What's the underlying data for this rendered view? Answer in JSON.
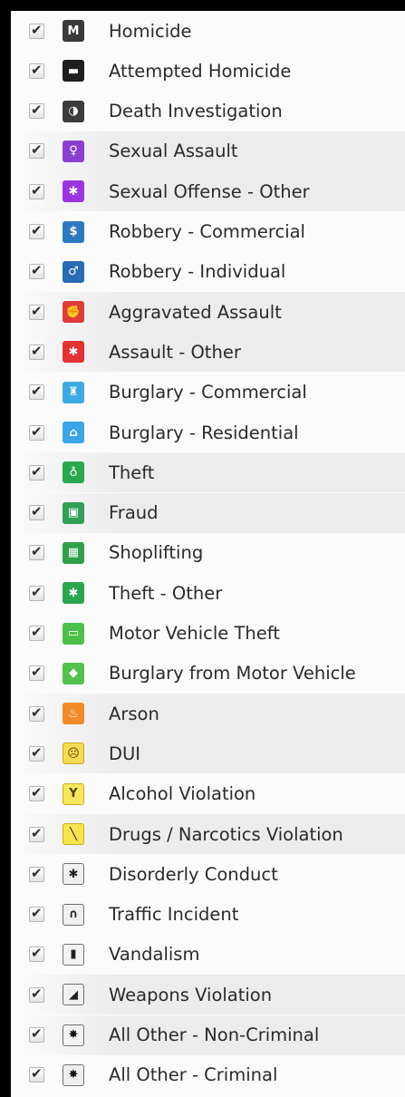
{
  "items": [
    {
      "label": "Homicide",
      "icon": "homicide-icon",
      "glyph": "M",
      "bg": "#3a3a3a",
      "fg": "#ffffff",
      "border": ""
    },
    {
      "label": "Attempted Homicide",
      "icon": "attempted-homicide-icon",
      "glyph": "▬",
      "bg": "#1e1e1e",
      "fg": "#ffffff",
      "border": ""
    },
    {
      "label": "Death Investigation",
      "icon": "death-investigation-icon",
      "glyph": "◑",
      "bg": "#3c3c3c",
      "fg": "#ffffff",
      "border": ""
    },
    {
      "label": "Sexual Assault",
      "icon": "sexual-assault-icon",
      "glyph": "♀",
      "bg": "#8b3fd0",
      "fg": "#ffffff",
      "border": ""
    },
    {
      "label": "Sexual Offense - Other",
      "icon": "sexual-offense-other-icon",
      "glyph": "✱",
      "bg": "#9a35e0",
      "fg": "#ffffff",
      "border": ""
    },
    {
      "label": "Robbery - Commercial",
      "icon": "robbery-commercial-icon",
      "glyph": "$",
      "bg": "#2d79c2",
      "fg": "#ffffff",
      "border": ""
    },
    {
      "label": "Robbery - Individual",
      "icon": "robbery-individual-icon",
      "glyph": "♂",
      "bg": "#2a6bb5",
      "fg": "#ffffff",
      "border": ""
    },
    {
      "label": "Aggravated Assault",
      "icon": "aggravated-assault-icon",
      "glyph": "✊",
      "bg": "#e03a3a",
      "fg": "#ffffff",
      "border": ""
    },
    {
      "label": "Assault - Other",
      "icon": "assault-other-icon",
      "glyph": "✱",
      "bg": "#e43232",
      "fg": "#ffffff",
      "border": ""
    },
    {
      "label": "Burglary - Commercial",
      "icon": "burglary-commercial-icon",
      "glyph": "♜",
      "bg": "#3fa9e6",
      "fg": "#ffffff",
      "border": ""
    },
    {
      "label": "Burglary - Residential",
      "icon": "burglary-residential-icon",
      "glyph": "⌂",
      "bg": "#3aa6e8",
      "fg": "#ffffff",
      "border": ""
    },
    {
      "label": "Theft",
      "icon": "theft-icon",
      "glyph": "♁",
      "bg": "#2aa84e",
      "fg": "#ffffff",
      "border": ""
    },
    {
      "label": "Fraud",
      "icon": "fraud-icon",
      "glyph": "▣",
      "bg": "#30a055",
      "fg": "#ffffff",
      "border": ""
    },
    {
      "label": "Shoplifting",
      "icon": "shoplifting-icon",
      "glyph": "▦",
      "bg": "#2ea04c",
      "fg": "#ffffff",
      "border": ""
    },
    {
      "label": "Theft - Other",
      "icon": "theft-other-icon",
      "glyph": "✱",
      "bg": "#2aa650",
      "fg": "#ffffff",
      "border": ""
    },
    {
      "label": "Motor Vehicle Theft",
      "icon": "motor-vehicle-theft-icon",
      "glyph": "▭",
      "bg": "#4cc14a",
      "fg": "#ffffff",
      "border": ""
    },
    {
      "label": "Burglary from Motor Vehicle",
      "icon": "burglary-from-motor-vehicle-icon",
      "glyph": "◆",
      "bg": "#52c24c",
      "fg": "#ffffff",
      "border": ""
    },
    {
      "label": "Arson",
      "icon": "arson-icon",
      "glyph": "♨",
      "bg": "#f28a2a",
      "fg": "#ffffff",
      "border": ""
    },
    {
      "label": "DUI",
      "icon": "dui-icon",
      "glyph": "☹",
      "bg": "#f5dc55",
      "fg": "#5a4a00",
      "border": "#c9a820"
    },
    {
      "label": "Alcohol Violation",
      "icon": "alcohol-violation-icon",
      "glyph": "Y",
      "bg": "#f7e65a",
      "fg": "#4a4000",
      "border": "#c9b020"
    },
    {
      "label": "Drugs / Narcotics Violation",
      "icon": "drugs-narcotics-violation-icon",
      "glyph": "╲",
      "bg": "#f6e44c",
      "fg": "#222222",
      "border": "#c9b020"
    },
    {
      "label": "Disorderly Conduct",
      "icon": "disorderly-conduct-icon",
      "glyph": "✱",
      "bg": "#f0f0f0",
      "fg": "#222222",
      "border": "#707070"
    },
    {
      "label": "Traffic Incident",
      "icon": "traffic-incident-icon",
      "glyph": "∩",
      "bg": "#f0f0f0",
      "fg": "#222222",
      "border": "#707070"
    },
    {
      "label": "Vandalism",
      "icon": "vandalism-icon",
      "glyph": "▮",
      "bg": "#f2f2f2",
      "fg": "#222222",
      "border": "#707070"
    },
    {
      "label": "Weapons Violation",
      "icon": "weapons-violation-icon",
      "glyph": "◢",
      "bg": "#f0f0f0",
      "fg": "#222222",
      "border": "#707070"
    },
    {
      "label": "All Other - Non-Criminal",
      "icon": "all-other-non-criminal-icon",
      "glyph": "✸",
      "bg": "#f3f3f3",
      "fg": "#111111",
      "border": "#707070"
    },
    {
      "label": "All Other - Criminal",
      "icon": "all-other-criminal-icon",
      "glyph": "✸",
      "bg": "#eeeeee",
      "fg": "#111111",
      "border": "#707070"
    }
  ],
  "shaded_rows": [
    3,
    4,
    7,
    8,
    11,
    12,
    17,
    18,
    20,
    24,
    25
  ],
  "checked": true
}
